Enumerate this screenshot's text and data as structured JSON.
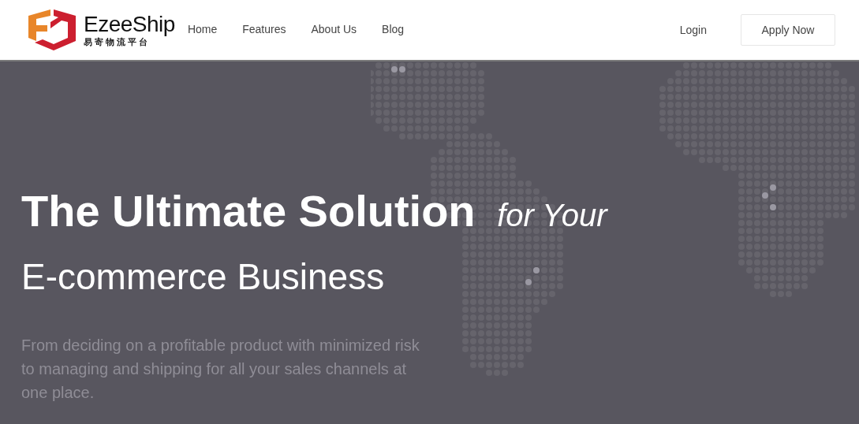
{
  "logo": {
    "name": "EzeeShip",
    "tagline": "易寄物流平台"
  },
  "nav": [
    {
      "label": "Home"
    },
    {
      "label": "Features"
    },
    {
      "label": "About Us"
    },
    {
      "label": "Blog"
    }
  ],
  "login": "Login",
  "apply_button": "Apply Now",
  "hero": {
    "title": "The Ultimate Solution",
    "title_suffix": "for Your",
    "subtitle": "E-commerce Business",
    "description": "From deciding on a profitable product with minimized risk to managing and shipping for all your sales channels at one place."
  }
}
